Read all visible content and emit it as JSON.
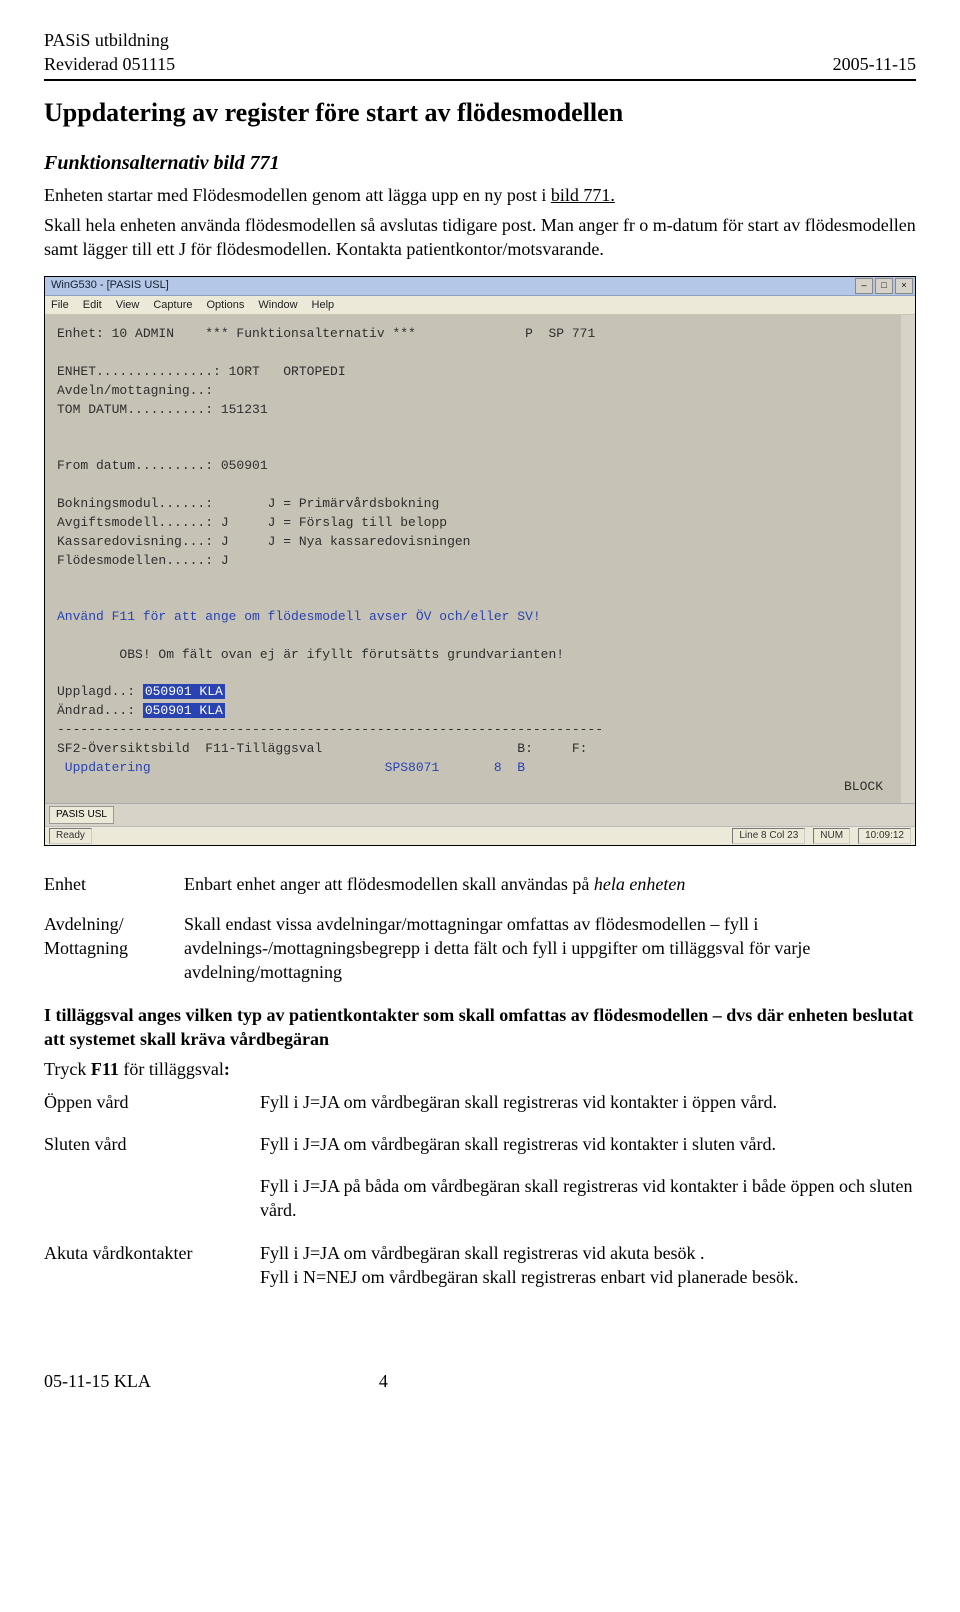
{
  "header": {
    "left1": "PASiS utbildning",
    "left2": "Reviderad 051115",
    "right": "2005-11-15"
  },
  "title": "Uppdatering av register före start av flödesmodellen",
  "subhead": "Funktionsalternativ bild 771",
  "intro1a": "Enheten startar med Flödesmodellen genom att lägga upp en ny post i ",
  "intro1b_u": "bild 771.",
  "intro2": "Skall hela enheten använda flödesmodellen så avslutas tidigare post. Man anger fr o m-datum för start av flödesmodellen samt lägger till ett J för flödesmodellen. Kontakta patientkontor/motsvarande.",
  "screenshot": {
    "windowTitle": "WinG530 - [PASIS USL]",
    "menu": [
      "File",
      "Edit",
      "View",
      "Capture",
      "Options",
      "Window",
      "Help"
    ],
    "close": "×",
    "max": "□",
    "min": "–",
    "line_enhet": "Enhet: 10 ADMIN    *** Funktionsalternativ ***              P  SP 771",
    "line_enhet2": "ENHET...............: 1ORT   ORTOPEDI",
    "line_avd": "Avdeln/mottagning..:",
    "line_tom": "TOM DATUM..........: 151231",
    "line_from": "From datum.........: 050901",
    "line_bok": "Bokningsmodul......:       J = Primärvårdsbokning",
    "line_avg": "Avgiftsmodell......: J     J = Förslag till belopp",
    "line_kassa": "Kassaredovisning...: J     J = Nya kassaredovisningen",
    "line_flod": "Flödesmodellen.....: J",
    "line_f11": "Använd F11 för att ange om flödesmodell avser ÖV och/eller SV!",
    "line_obs": "        OBS! Om fält ovan ej är ifyllt förutsätts grundvarianten!",
    "line_upp_lbl": "Upplagd..: ",
    "line_upp_val": "050901 KLA",
    "line_andr_lbl": "Ändrad...: ",
    "line_andr_val": "050901 KLA",
    "line_sf2": "SF2-Översiktsbild  F11-Tilläggsval                         B:     F:",
    "line_upd": " Uppdatering                              SPS8071       8  B",
    "block": "BLOCK",
    "taskbtn": "PASIS USL",
    "status_ready": "Ready",
    "status_pos": "Line 8 Col 23",
    "status_num": "NUM",
    "status_time": "10:09:12"
  },
  "defs": {
    "enhetLabel": "Enhet",
    "enhetText_a": "Enbart enhet anger att flödesmodellen skall användas på ",
    "enhetText_b_em": "hela enheten",
    "avdLabel1": "Avdelning/",
    "avdLabel2": "Mottagning",
    "avdText": "Skall endast vissa avdelningar/mottagningar omfattas av flödesmodellen – fyll i avdelnings-/mottagningsbegrepp i detta fält och fyll i uppgifter om tilläggsval för varje avdelning/mottagning"
  },
  "tilagg": "I tilläggsval anges vilken typ av patientkontakter som skall omfattas av flödesmodellen – dvs där enheten beslutat att systemet skall kräva vårdbegäran",
  "tryck_a": "Tryck ",
  "tryck_b": "F11",
  "tryck_c": " för tilläggsval",
  "tryck_colon": ":",
  "answers": {
    "oppenLbl": "Öppen vård",
    "oppenTxt": "Fyll i J=JA om vårdbegäran skall registreras vid kontakter i öppen vård.",
    "slutenLbl": "Sluten vård",
    "slutenTxt": "Fyll i J=JA om vårdbegäran skall registreras vid kontakter i sluten vård.",
    "bothTxt": "Fyll i J=JA på båda om vårdbegäran skall registreras vid kontakter i både öppen och sluten vård.",
    "akutaLbl": "Akuta vårdkontakter",
    "akutaTxt1": "Fyll i J=JA om vårdbegäran skall registreras vid akuta besök .",
    "akutaTxt2": "Fyll i N=NEJ om vårdbegäran skall registreras enbart vid planerade besök."
  },
  "footer": {
    "left": "05-11-15 KLA",
    "page": "4"
  }
}
